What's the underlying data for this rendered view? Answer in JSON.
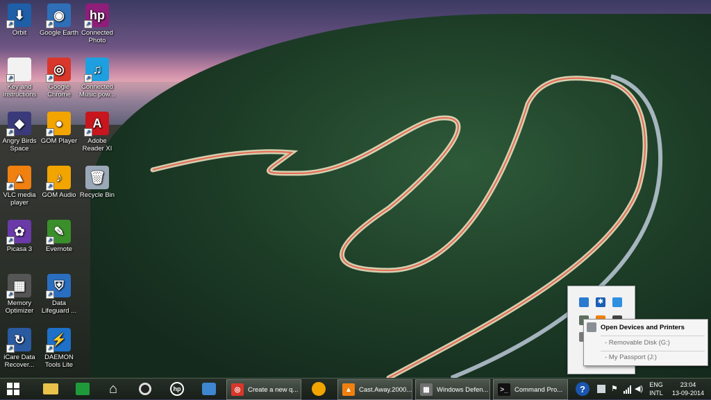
{
  "desktop": {
    "icons": [
      {
        "label": "Orbit",
        "glyph": "⬇",
        "color": "#1e5fa8"
      },
      {
        "label": "Google Earth",
        "glyph": "◉",
        "color": "#2f6fb8"
      },
      {
        "label": "Connected Photo",
        "glyph": "hp",
        "color": "#8e1e7a"
      },
      {
        "label": "Key and Instructions",
        "glyph": "",
        "color": "#f2f2f2"
      },
      {
        "label": "Google Chrome",
        "glyph": "◎",
        "color": "#d9372b"
      },
      {
        "label": "Connected Music pow...",
        "glyph": "♫",
        "color": "#1ea0e0"
      },
      {
        "label": "Angry Birds Space",
        "glyph": "◆",
        "color": "#3a3a7a"
      },
      {
        "label": "GOM Player",
        "glyph": "●",
        "color": "#f2a400"
      },
      {
        "label": "Adobe Reader XI",
        "glyph": "A",
        "color": "#c7161d"
      },
      {
        "label": "VLC media player",
        "glyph": "▲",
        "color": "#f08010"
      },
      {
        "label": "GOM Audio",
        "glyph": "♪",
        "color": "#f2a400"
      },
      {
        "label": "Recycle Bin",
        "glyph": "🗑",
        "color": "#9aa8b8"
      },
      {
        "label": "Picasa 3",
        "glyph": "✿",
        "color": "#6a3aa8"
      },
      {
        "label": "Evernote",
        "glyph": "✎",
        "color": "#3b8f2a"
      },
      {
        "label": "Memory Optimizer",
        "glyph": "▦",
        "color": "#555"
      },
      {
        "label": "Data Lifeguard ...",
        "glyph": "⛨",
        "color": "#2a6ec0"
      },
      {
        "label": "iCare Data Recover...",
        "glyph": "↻",
        "color": "#2a5aa0"
      },
      {
        "label": "DAEMON Tools Lite",
        "glyph": "⚡",
        "color": "#1e70c8"
      }
    ]
  },
  "context_menu": {
    "title": "Open Devices and Printers",
    "items": [
      "- Removable Disk (G:)",
      "- My Passport (J:)"
    ]
  },
  "taskbar": {
    "tasks": [
      {
        "label": "Create a new q...",
        "glyph": "◎",
        "color": "#d9372b"
      },
      {
        "label": "Cast.Away.2000...",
        "glyph": "▲",
        "color": "#f08010"
      },
      {
        "label": "Windows Defen...",
        "glyph": "▦",
        "color": "#707070"
      },
      {
        "label": "Command Pro...",
        "glyph": ">_",
        "color": "#111"
      }
    ],
    "language": "ENG",
    "keyboard": "INTL",
    "time": "23:04",
    "date": "13-09-2014"
  }
}
